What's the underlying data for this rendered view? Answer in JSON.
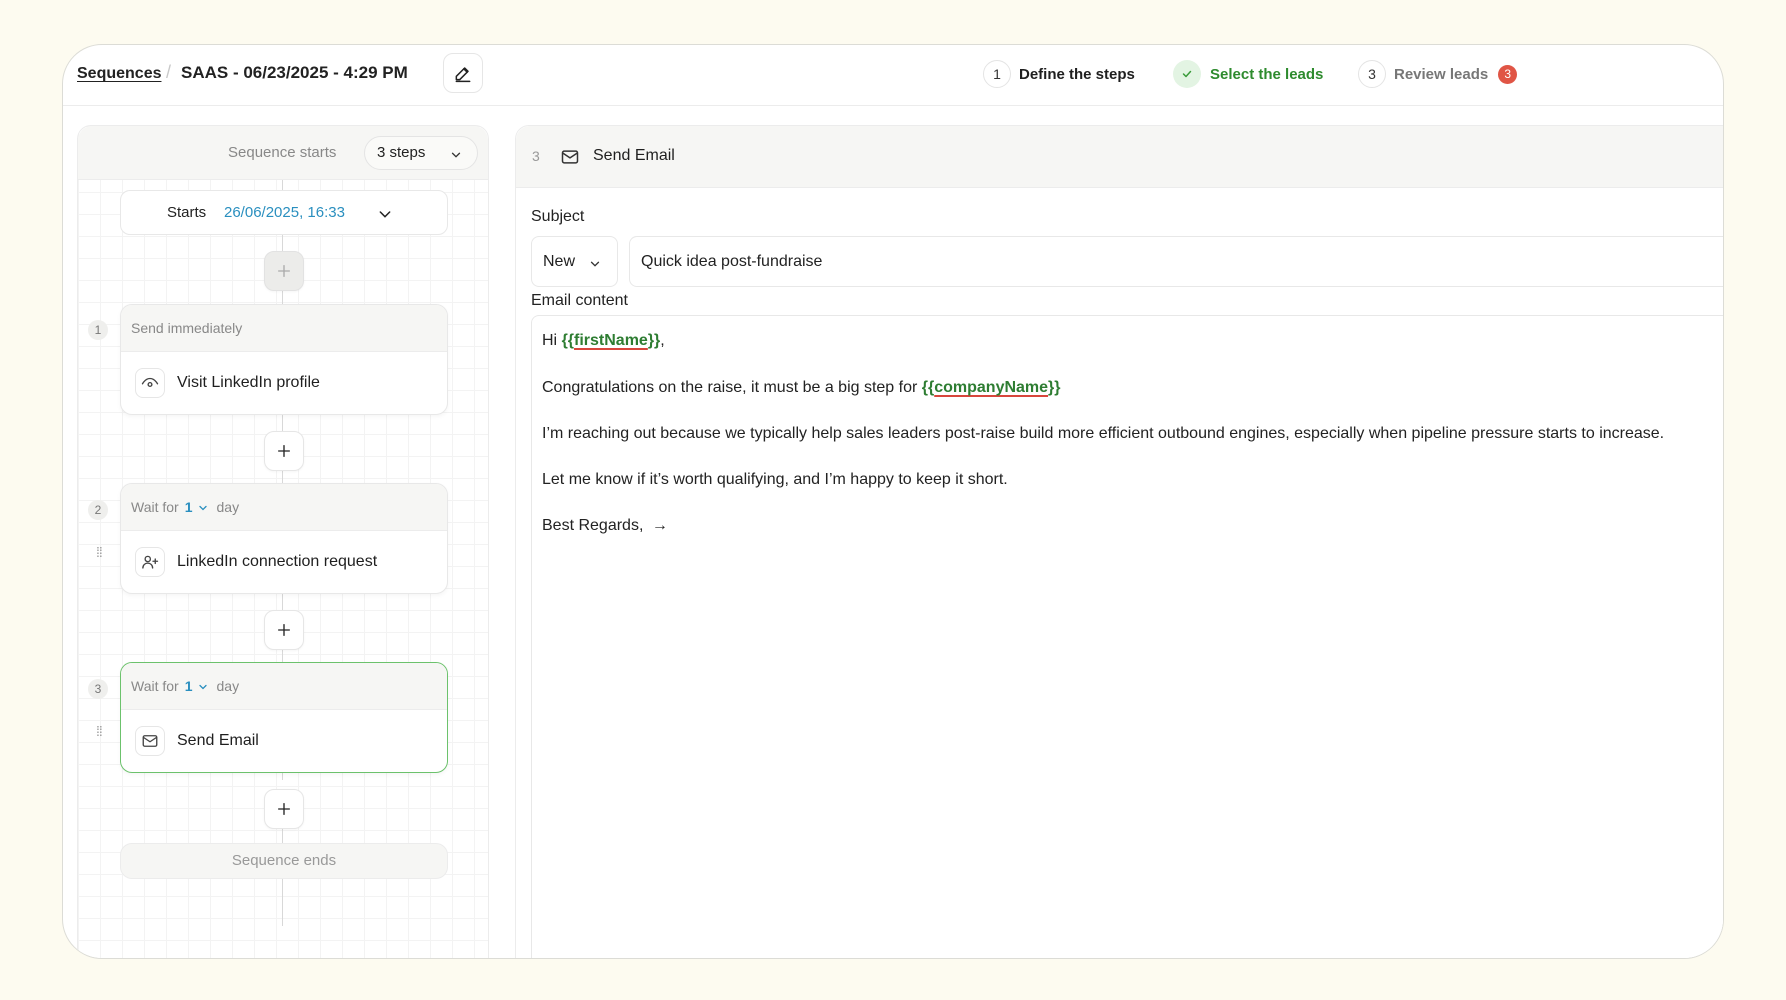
{
  "header": {
    "breadcrumb": "Sequences",
    "separator": "/",
    "title": "SAAS - 06/23/2025 - 4:29 PM",
    "steps": [
      {
        "number": "1",
        "label": "Define the steps",
        "state": "active"
      },
      {
        "number": "",
        "label": "Select the leads",
        "state": "done"
      },
      {
        "number": "3",
        "label": "Review leads",
        "state": "todo",
        "badge": "3"
      }
    ]
  },
  "sidebar": {
    "header_label": "Sequence starts",
    "steps_dropdown": "3 steps",
    "starts_label": "Starts",
    "starts_value": "26/06/2025, 16:33",
    "items": [
      {
        "index": "1",
        "timing": "Send immediately",
        "action": "Visit LinkedIn profile",
        "icon": "eye-icon"
      },
      {
        "index": "2",
        "wait_prefix": "Wait for",
        "wait_value": "1",
        "wait_unit": "day",
        "action": "LinkedIn connection request",
        "icon": "user-plus-icon"
      },
      {
        "index": "3",
        "wait_prefix": "Wait for",
        "wait_value": "1",
        "wait_unit": "day",
        "action": "Send Email",
        "icon": "mail-icon"
      }
    ],
    "end_label": "Sequence ends"
  },
  "editor": {
    "step_number": "3",
    "step_title": "Send Email",
    "subject_label": "Subject",
    "subject_mode": "New",
    "subject_value": "Quick idea post-fundraise",
    "content_label": "Email content",
    "greeting_prefix": "Hi ",
    "var_first_open": "{{",
    "var_first_name": "firstName",
    "var_first_close": "}}",
    "greeting_suffix": ",",
    "line2_prefix": "Congratulations on the raise, it must be a big step for ",
    "var_company_open": "{{",
    "var_company_name": "companyName",
    "var_company_close": "}}",
    "line3": "I’m reaching out because we typically help sales leaders post-raise build more efficient outbound engines, especially when pipeline pressure starts to increase.",
    "line4": "Let me know if it’s worth qualifying, and I’m happy to keep it short.",
    "line5": "Best Regards,",
    "arrow": "→"
  },
  "colors": {
    "accent_blue": "#2a8fbf",
    "success_green": "#2e8b2e",
    "badge_red": "#e05545",
    "background": "#fdfbf0"
  }
}
